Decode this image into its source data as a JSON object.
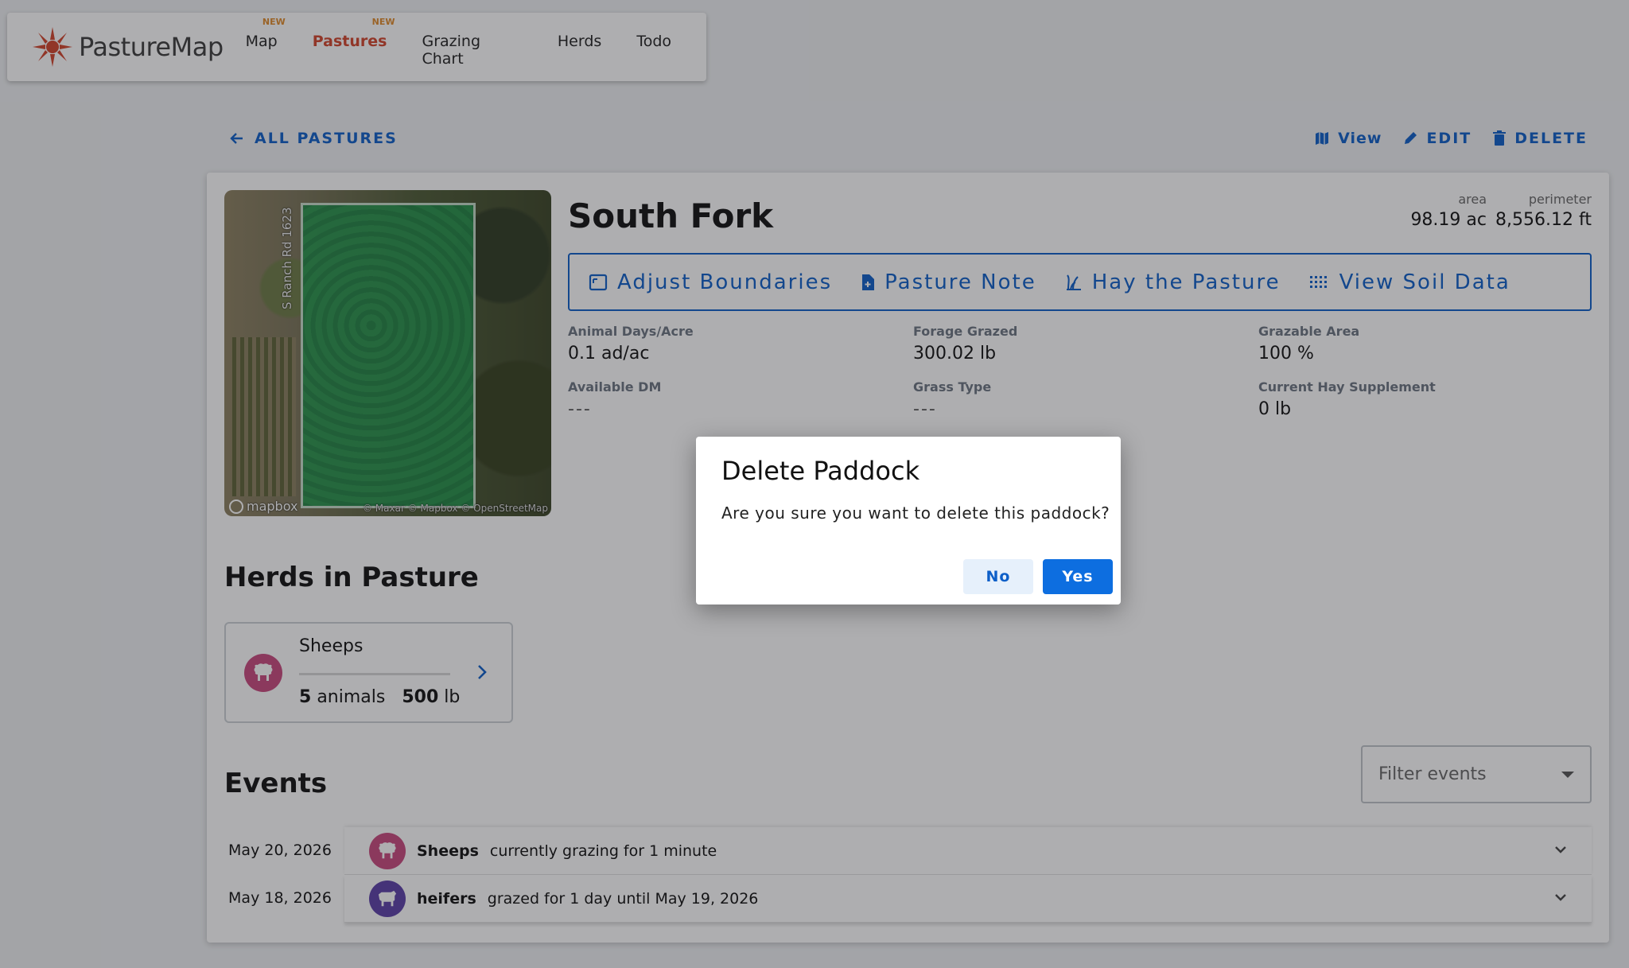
{
  "app": {
    "name": "PastureMap"
  },
  "nav": {
    "items": [
      {
        "label": "Map",
        "badge": "NEW"
      },
      {
        "label": "Pastures",
        "badge": "NEW"
      },
      {
        "label": "Grazing Chart",
        "badge": ""
      },
      {
        "label": "Herds",
        "badge": ""
      },
      {
        "label": "Todo",
        "badge": ""
      }
    ],
    "active": "Pastures"
  },
  "toolbar": {
    "back_label": "ALL PASTURES",
    "view_label": "View",
    "edit_label": "EDIT",
    "delete_label": "DELETE"
  },
  "map": {
    "road_label": "S Ranch Rd 1623",
    "logo": "mapbox",
    "attribution": "© Maxar © Mapbox © OpenStreetMap"
  },
  "pasture": {
    "title": "South Fork",
    "area_label": "area",
    "area_value": "98.19 ac",
    "perimeter_label": "perimeter",
    "perimeter_value": "8,556.12 ft"
  },
  "tools": {
    "adjust": "Adjust Boundaries",
    "note": "Pasture Note",
    "hay": "Hay the Pasture",
    "soil": "View Soil Data"
  },
  "metrics": [
    {
      "label": "Animal Days/Acre",
      "value": "0.1 ad/ac"
    },
    {
      "label": "Forage Grazed",
      "value": "300.02 lb"
    },
    {
      "label": "Grazable Area",
      "value": "100 %"
    },
    {
      "label": "Available DM",
      "value": "---"
    },
    {
      "label": "Grass Type",
      "value": "---"
    },
    {
      "label": "Current Hay Supplement",
      "value": "0 lb"
    }
  ],
  "herds": {
    "title": "Herds in Pasture",
    "items": [
      {
        "name": "Sheeps",
        "animals_count": "5",
        "animals_unit": "animals",
        "weight": "500",
        "weight_unit": "lb"
      }
    ]
  },
  "events": {
    "title": "Events",
    "filter_placeholder": "Filter events",
    "items": [
      {
        "date": "May 20, 2026",
        "herd": "Sheeps",
        "text": "currently grazing for 1 minute",
        "color": "#c8497e"
      },
      {
        "date": "May 18, 2026",
        "herd": "heifers",
        "text": "grazed for 1 day until May 19, 2026",
        "color": "#5b3fa8"
      }
    ]
  },
  "dialog": {
    "title": "Delete Paddock",
    "message": "Are you sure you want to delete this paddock?",
    "no_label": "No",
    "yes_label": "Yes"
  },
  "colors": {
    "accent": "#0d5fc8",
    "brand": "#d2442b",
    "primary_button": "#0d6ee0"
  }
}
